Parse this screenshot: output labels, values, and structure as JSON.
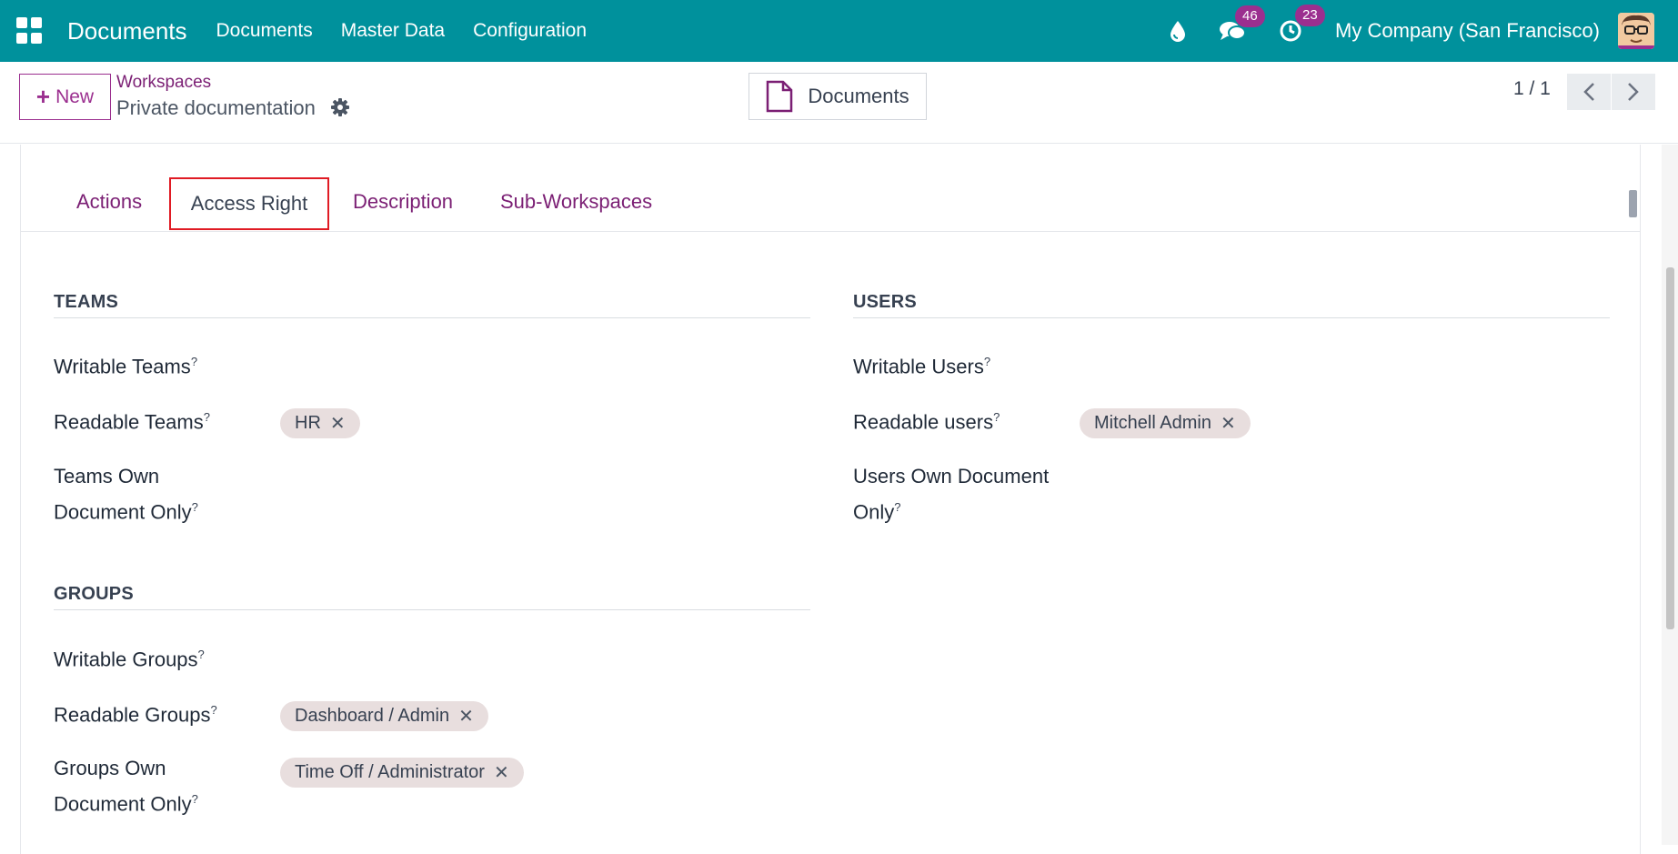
{
  "navbar": {
    "app_title": "Documents",
    "menu": [
      "Documents",
      "Master Data",
      "Configuration"
    ],
    "messages_count": "46",
    "activities_count": "23",
    "company": "My Company (San Francisco)"
  },
  "control": {
    "new_label": "New",
    "breadcrumb_parent": "Workspaces",
    "breadcrumb_current": "Private documentation",
    "documents_button": "Documents",
    "pager": "1 / 1"
  },
  "tabs": [
    "Actions",
    "Access Right",
    "Description",
    "Sub-Workspaces"
  ],
  "active_tab": "Access Right",
  "teams": {
    "title": "TEAMS",
    "writable_label": "Writable Teams",
    "readable_label": "Readable Teams",
    "readable_tags": [
      "HR"
    ],
    "own_label_1": "Teams Own",
    "own_label_2": "Document Only"
  },
  "users": {
    "title": "USERS",
    "writable_label": "Writable Users",
    "readable_label": "Readable users",
    "readable_tags": [
      "Mitchell Admin"
    ],
    "own_label_1": "Users Own Document",
    "own_label_2": "Only"
  },
  "groups": {
    "title": "GROUPS",
    "writable_label": "Writable Groups",
    "readable_label": "Readable Groups",
    "readable_tags": [
      "Dashboard / Admin"
    ],
    "own_label_1": "Groups Own",
    "own_label_2": "Document Only",
    "own_tags": [
      "Time Off / Administrator"
    ]
  },
  "help_mark": "?",
  "colors": {
    "navbar": "#00919c",
    "primary": "#7b1f74",
    "badge": "#9b2f8f",
    "highlight": "#e01b24",
    "tag_bg": "#e8dede"
  }
}
